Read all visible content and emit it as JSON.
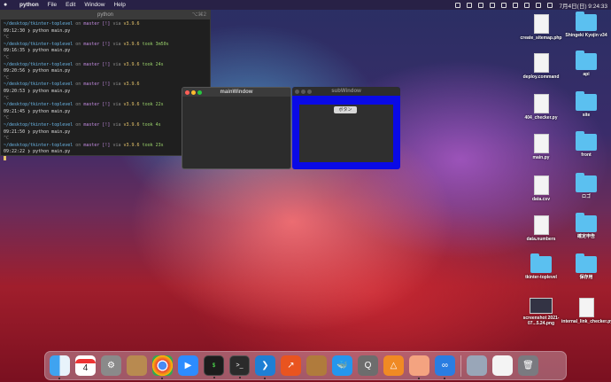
{
  "menubar": {
    "app": "python",
    "items": [
      "File",
      "Edit",
      "Window",
      "Help"
    ],
    "datetime": "7月4日(日)  9:24:33"
  },
  "terminal": {
    "title": "python",
    "shortcut": "⌥⌘2",
    "lines": [
      {
        "path": "~/desktop/tkinter-toplevel",
        "rest": " on ",
        "branch": "master [!]",
        "via": " via ",
        "py": "v3.9.6",
        "took": ""
      },
      {
        "prompt": "09:12:30 ❯ python main.py"
      },
      {
        "blank": "^C"
      },
      {
        "path": "~/desktop/tkinter-toplevel",
        "rest": " on ",
        "branch": "master [!]",
        "via": " via ",
        "py": "v3.9.6",
        "took": " took 3m50s"
      },
      {
        "prompt": "09:16:35 ❯ python main.py"
      },
      {
        "blank": "^C"
      },
      {
        "path": "~/desktop/tkinter-toplevel",
        "rest": " on ",
        "branch": "master [!]",
        "via": " via ",
        "py": "v3.9.6",
        "took": " took 24s"
      },
      {
        "prompt": "09:20:56 ❯ python main.py"
      },
      {
        "blank": "^C"
      },
      {
        "path": "~/desktop/tkinter-toplevel",
        "rest": " on ",
        "branch": "master [!]",
        "via": " via ",
        "py": "v3.9.6",
        "took": ""
      },
      {
        "prompt": "09:20:53 ❯ python main.py"
      },
      {
        "blank": "^C"
      },
      {
        "path": "~/desktop/tkinter-toplevel",
        "rest": " on ",
        "branch": "master [!]",
        "via": " via ",
        "py": "v3.9.6",
        "took": " took 22s"
      },
      {
        "prompt": "09:21:45 ❯ python main.py"
      },
      {
        "blank": "^C"
      },
      {
        "path": "~/desktop/tkinter-toplevel",
        "rest": " on ",
        "branch": "master [!]",
        "via": " via ",
        "py": "v3.9.6",
        "took": " took 4s"
      },
      {
        "prompt": "09:21:50 ❯ python main.py"
      },
      {
        "blank": "^C"
      },
      {
        "path": "~/desktop/tkinter-toplevel",
        "rest": " on ",
        "branch": "master [!]",
        "via": " via ",
        "py": "v3.9.6",
        "took": " took 23s"
      },
      {
        "prompt": "09:22:22 ❯ python main.py"
      }
    ]
  },
  "mainwin": {
    "title": "mainWindow"
  },
  "subwin": {
    "title": "subWindow",
    "button": "ボタン"
  },
  "desktop_icons": [
    {
      "label": "create_sitemap.php",
      "kind": "doc"
    },
    {
      "label": "Shingeki Kyojin v34",
      "kind": "folder"
    },
    {
      "label": "deploy.command",
      "kind": "doc"
    },
    {
      "label": "api",
      "kind": "folder"
    },
    {
      "label": "404_checker.py",
      "kind": "doc"
    },
    {
      "label": "site",
      "kind": "folder"
    },
    {
      "label": "main.py",
      "kind": "doc"
    },
    {
      "label": "front",
      "kind": "folder"
    },
    {
      "label": "data.csv",
      "kind": "doc"
    },
    {
      "label": "ロゴ",
      "kind": "folder"
    },
    {
      "label": "data.numbers",
      "kind": "doc"
    },
    {
      "label": "確定申告",
      "kind": "folder"
    },
    {
      "label": "tkinter-toplevel",
      "kind": "folder"
    },
    {
      "label": "保存用",
      "kind": "folder"
    },
    {
      "label": "screenshot 2021-07...5.24.png",
      "kind": "thumb"
    },
    {
      "label": "internal_link_checker.py",
      "kind": "doc"
    }
  ],
  "dock": {
    "calendar_day": "4",
    "terminal_label": ">_",
    "items": [
      "finder-icon",
      "calendar-icon",
      "system-preferences-icon",
      "contacts-icon",
      "chrome-icon",
      "zoom-icon",
      "terminal-icon",
      "iterm-icon",
      "vscode-icon",
      "trend-icon",
      "archive-icon",
      "docker-icon",
      "quicktime-icon",
      "diagram-icon",
      "preview-icon",
      "infinity-icon",
      "screenshot-icon",
      "document-icon",
      "trash-icon"
    ]
  }
}
